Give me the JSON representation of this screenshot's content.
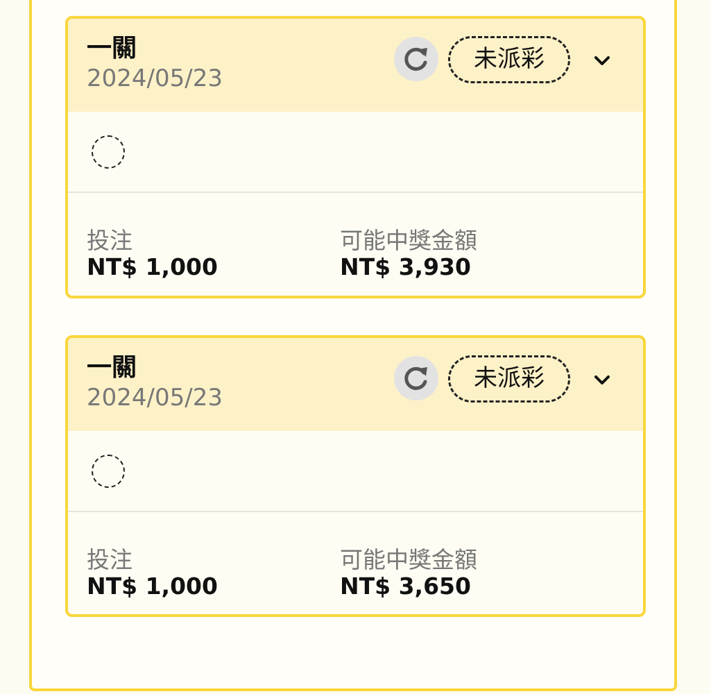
{
  "bets": [
    {
      "type": "一關",
      "date": "2024/05/23",
      "status": "未派彩",
      "stake_label": "投注",
      "stake_value": "NT$ 1,000",
      "payout_label": "可能中獎金額",
      "payout_value": "NT$ 3,930"
    },
    {
      "type": "一關",
      "date": "2024/05/23",
      "status": "未派彩",
      "stake_label": "投注",
      "stake_value": "NT$ 1,000",
      "payout_label": "可能中獎金額",
      "payout_value": "NT$ 3,650"
    }
  ],
  "icons": {
    "refresh": "refresh-icon",
    "expand": "chevron-down-icon",
    "pending": "pending-circle-icon"
  },
  "colors": {
    "accent": "#f9d63c",
    "header_bg": "#fdf1c7",
    "card_bg": "#fffdf3"
  }
}
